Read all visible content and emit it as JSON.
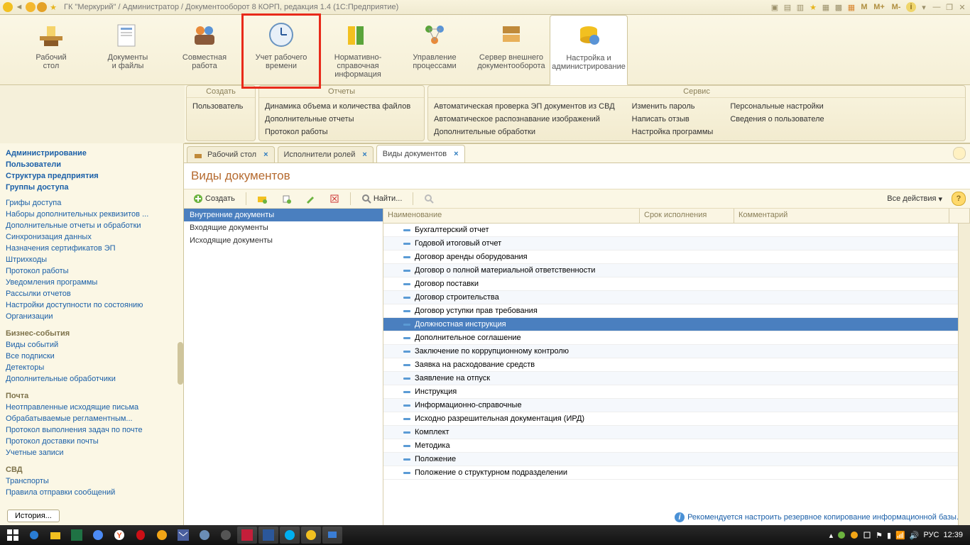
{
  "title": "ГК \"Меркурий\" / Администратор / Документооборот 8 КОРП, редакция 1.4  (1С:Предприятие)",
  "titlebar_right": [
    "M",
    "M+",
    "M-"
  ],
  "main_toolbar": [
    {
      "label": "Рабочий\nстол"
    },
    {
      "label": "Документы\nи файлы"
    },
    {
      "label": "Совместная\nработа"
    },
    {
      "label": "Учет рабочего\nвремени",
      "highlight": true
    },
    {
      "label": "Нормативно-справочная\nинформация"
    },
    {
      "label": "Управление\nпроцессами"
    },
    {
      "label": "Сервер внешнего\nдокументооборота"
    },
    {
      "label": "Настройка и\nадминистрирование",
      "selected": true
    }
  ],
  "ribbon": {
    "create": {
      "head": "Создать",
      "items": [
        "Пользователь"
      ]
    },
    "reports": {
      "head": "Отчеты",
      "items": [
        "Динамика объема и количества файлов",
        "Дополнительные отчеты",
        "Протокол работы"
      ]
    },
    "service": {
      "head": "Сервис",
      "cols": [
        [
          "Автоматическая проверка ЭП документов из СВД",
          "Автоматическое распознавание изображений",
          "Дополнительные обработки"
        ],
        [
          "Изменить пароль",
          "Написать отзыв",
          "Настройка программы"
        ],
        [
          "Персональные настройки",
          "Сведения о пользователе"
        ]
      ]
    }
  },
  "left_nav": {
    "top_bold": [
      "Администрирование",
      "Пользователи",
      "Структура предприятия",
      "Группы доступа"
    ],
    "top": [
      "Грифы доступа",
      "Наборы дополнительных реквизитов ...",
      "Дополнительные отчеты и обработки",
      "Синхронизация данных",
      "Назначения сертификатов ЭП",
      "Штрихкоды",
      "Протокол работы",
      "Уведомления программы",
      "Рассылки отчетов",
      "Настройки доступности по состоянию",
      "Организации"
    ],
    "biz_head": "Бизнес-события",
    "biz": [
      "Виды событий",
      "Все подписки",
      "Детекторы",
      "Дополнительные обработчики"
    ],
    "mail_head": "Почта",
    "mail": [
      "Неотправленные исходящие письма",
      "Обрабатываемые регламентным...",
      "Протокол выполнения задач по почте",
      "Протокол доставки почты",
      "Учетные записи"
    ],
    "svd_head": "СВД",
    "svd": [
      "Транспорты",
      "Правила отправки сообщений"
    ]
  },
  "tabs": [
    {
      "label": "Рабочий стол",
      "closable": true,
      "icon": true
    },
    {
      "label": "Исполнители ролей",
      "closable": true
    },
    {
      "label": "Виды документов",
      "closable": true,
      "active": true
    }
  ],
  "page_title": "Виды документов",
  "cmd": {
    "create": "Создать",
    "find": "Найти...",
    "all_actions": "Все действия"
  },
  "tree": [
    {
      "label": "Внутренние документы",
      "sel": true
    },
    {
      "label": "Входящие документы"
    },
    {
      "label": "Исходящие документы"
    }
  ],
  "grid": {
    "cols": [
      "Наименование",
      "Срок исполнения",
      "Комментарий"
    ],
    "rows": [
      "Бухгалтерский отчет",
      "Годовой итоговый отчет",
      "Договор аренды оборудования",
      "Договор о полной материальной ответственности",
      "Договор поставки",
      "Договор строительства",
      "Договор уступки прав требования",
      {
        "t": "Должностная инструкция",
        "sel": true
      },
      "Дополнительное соглашение",
      "Заключение по коррупционному контролю",
      "Заявка на расходование средств",
      "Заявление на отпуск",
      "Инструкция",
      "Информационно-справочные",
      "Исходно разрешительная документация (ИРД)",
      "Комплект",
      "Методика",
      "Положение",
      "Положение о структурном подразделении"
    ]
  },
  "history_btn": "История...",
  "bottom_info": "Рекомендуется настроить резервное копирование информационной базы.",
  "taskbar": {
    "lang": "РУС",
    "time": "12:39"
  }
}
